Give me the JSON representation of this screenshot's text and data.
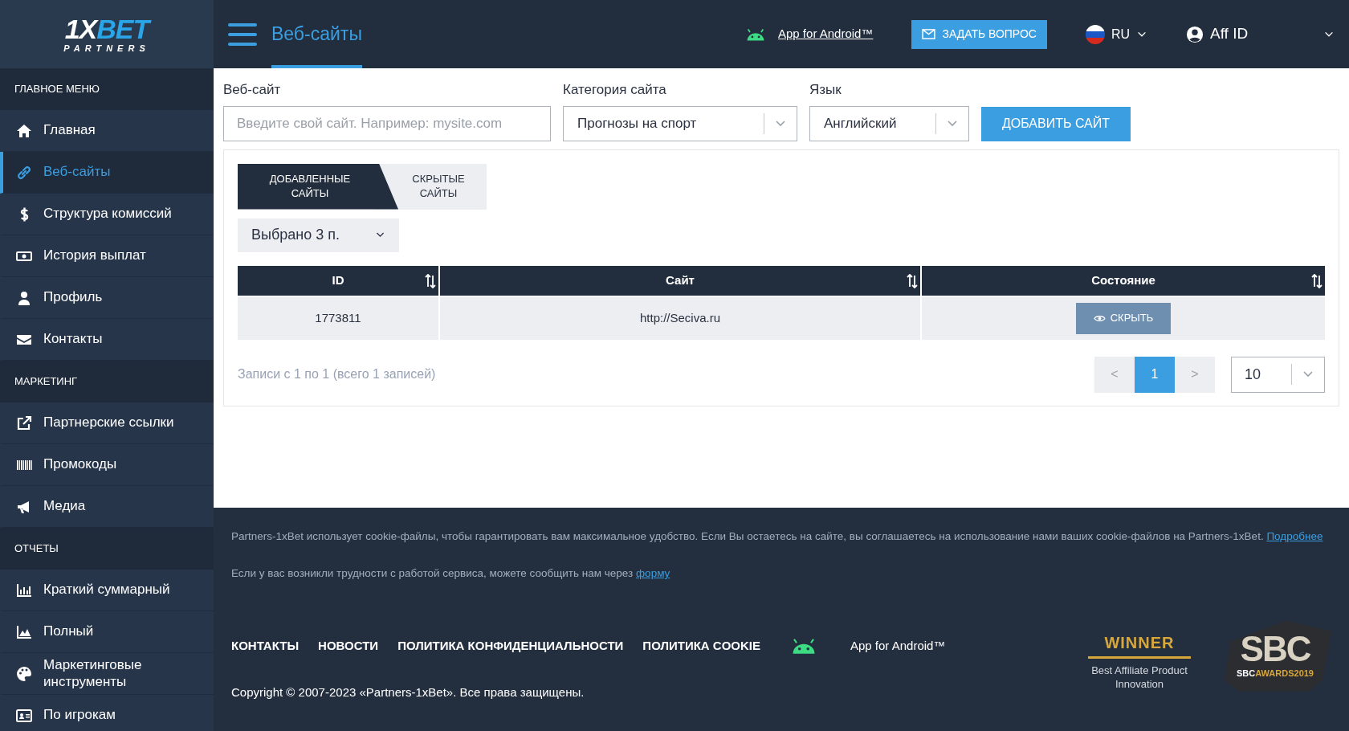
{
  "sidebar": {
    "logo": {
      "mark_1": "1X",
      "mark_2": "BET",
      "subtitle": "PARTNERS"
    },
    "sections": [
      {
        "title": "ГЛАВНОЕ МЕНЮ",
        "items": [
          {
            "label": "Главная",
            "selected": false
          },
          {
            "label": "Веб-сайты",
            "selected": true
          },
          {
            "label": "Структура комиссий",
            "selected": false
          },
          {
            "label": "История выплат",
            "selected": false
          },
          {
            "label": "Профиль",
            "selected": false
          },
          {
            "label": "Контакты",
            "selected": false
          }
        ]
      },
      {
        "title": "МАРКЕТИНГ",
        "items": [
          {
            "label": "Партнерские ссылки",
            "selected": false
          },
          {
            "label": "Промокоды",
            "selected": false
          },
          {
            "label": "Медиа",
            "selected": false
          }
        ]
      },
      {
        "title": "ОТЧЕТЫ",
        "items": [
          {
            "label": "Краткий суммарный",
            "selected": false
          },
          {
            "label": "Полный",
            "selected": false
          },
          {
            "label": "Маркетинговые инструменты",
            "selected": false
          },
          {
            "label": "По игрокам",
            "selected": false
          }
        ]
      }
    ]
  },
  "header": {
    "title": "Веб-сайты",
    "app_link": "App for Android™",
    "ask_button": "ЗАДАТЬ ВОПРОС",
    "language": "RU",
    "user": "Aff ID"
  },
  "form": {
    "fields": [
      {
        "kind": "input",
        "label": "Веб-сайт",
        "placeholder": "Введите свой сайт. Например: mysite.com"
      },
      {
        "kind": "select",
        "label": "Категория сайта",
        "value": "Прогнозы на спорт"
      },
      {
        "kind": "select",
        "label": "Язык",
        "value": "Английский"
      }
    ],
    "add_button": "ДОБАВИТЬ САЙТ"
  },
  "tabs": [
    {
      "label": "ДОБАВЛЕННЫЕ САЙТЫ",
      "selected": true
    },
    {
      "label": "СКРЫТЫЕ САЙТЫ",
      "selected": false
    }
  ],
  "columns_select": "Выбрано 3 п.",
  "table": {
    "columns": [
      "ID",
      "Сайт",
      "Состояние"
    ],
    "rows": [
      {
        "id": "1773811",
        "site": "http://Seciva.ru",
        "action": "СКРЫТЬ"
      }
    ]
  },
  "records_info": "Записи с 1 по 1 (всего 1 записей)",
  "pagination": {
    "prev": "<",
    "pages": [
      {
        "label": "1",
        "selected": true
      }
    ],
    "next": ">",
    "page_size": "10"
  },
  "footer": {
    "cookie_notice": {
      "text": "Partners-1xBet использует cookie-файлы, чтобы гарантировать вам максимальное удобство. Если Вы остаетесь на сайте, вы соглашаетесь на использование нами ваших cookie-файлов на Partners-1xBet.",
      "link": "Подробнее"
    },
    "support": {
      "text": "Если у вас возникли трудности с работой сервиса, можете сообщить нам через",
      "link": "форму"
    },
    "links": [
      "КОНТАКТЫ",
      "НОВОСТИ",
      "ПОЛИТИКА КОНФИДЕНЦИАЛЬНОСТИ",
      "ПОЛИТИКА COOKIE"
    ],
    "app_link": "App for Android™",
    "copyright": "Copyright © 2007-2023 «Partners-1xBet». Все права защищены.",
    "award": {
      "title": "WINNER",
      "text": "Best Affiliate Product Innovation"
    },
    "sbc_badge": {
      "logo": "SBC",
      "caption": "**SBC**AWARDS2019"
    }
  }
}
